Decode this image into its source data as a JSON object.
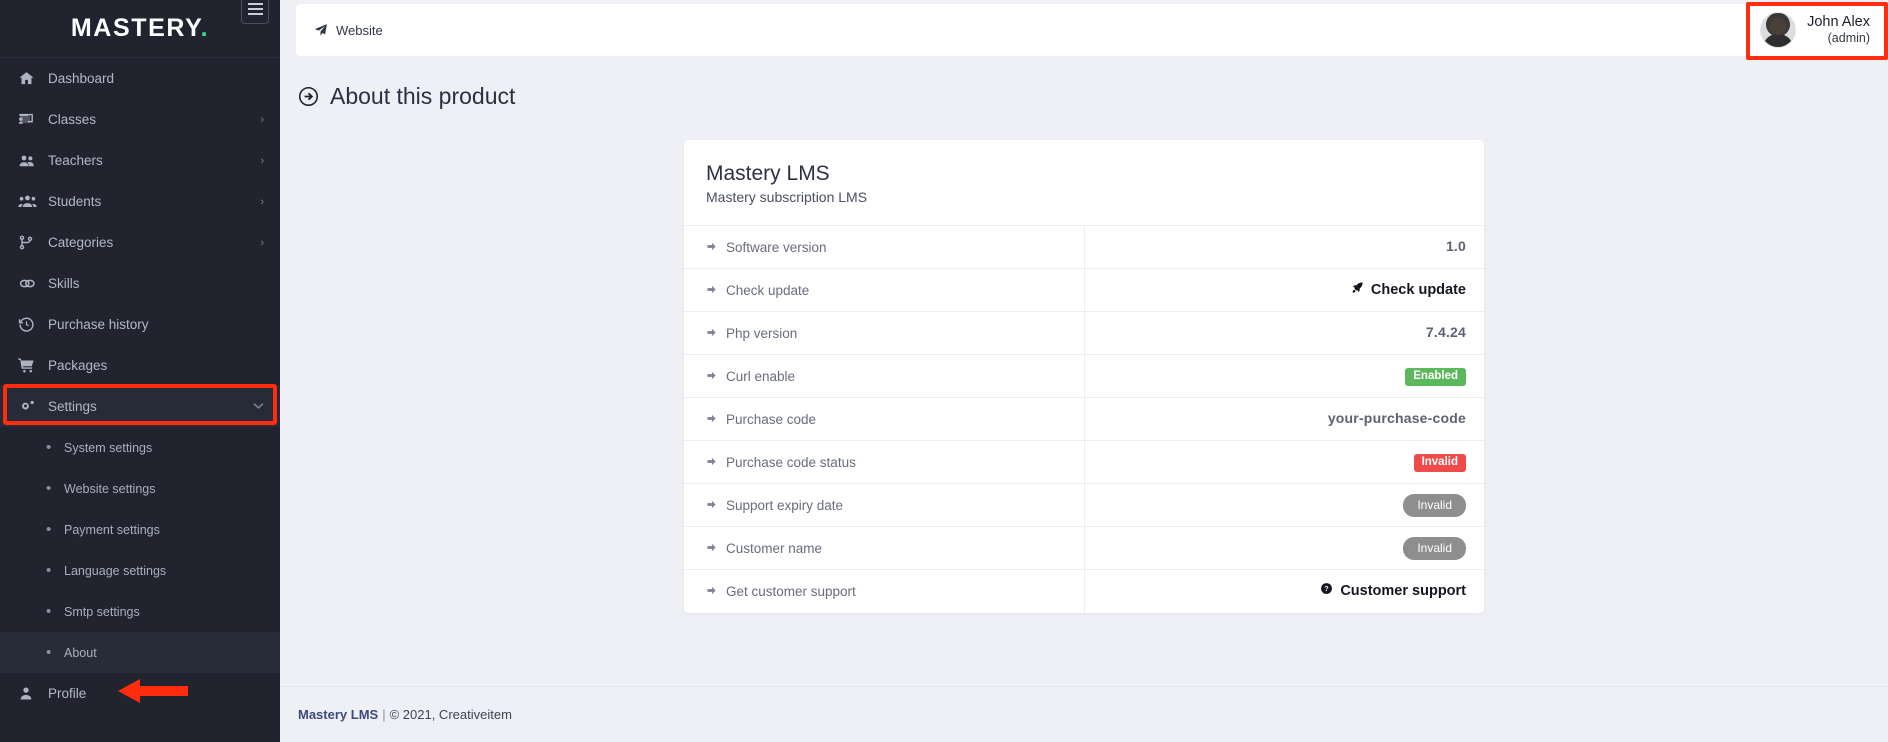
{
  "brand": {
    "name": "MASTERY",
    "dot": ".",
    "accent": "#3ddc84"
  },
  "sidebar": {
    "menu_icon": "hamburger-icon",
    "items": [
      {
        "label": "Dashboard",
        "icon": "home-icon",
        "caret": ""
      },
      {
        "label": "Classes",
        "icon": "classes-icon",
        "caret": "›"
      },
      {
        "label": "Teachers",
        "icon": "teachers-icon",
        "caret": "›"
      },
      {
        "label": "Students",
        "icon": "students-icon",
        "caret": "›"
      },
      {
        "label": "Categories",
        "icon": "category-icon",
        "caret": "›"
      },
      {
        "label": "Skills",
        "icon": "skills-icon",
        "caret": ""
      },
      {
        "label": "Purchase history",
        "icon": "history-icon",
        "caret": ""
      },
      {
        "label": "Packages",
        "icon": "cart-icon",
        "caret": ""
      }
    ],
    "settings": {
      "label": "Settings",
      "icon": "gears-icon",
      "caret": "⌄"
    },
    "sub_items": [
      {
        "label": "System settings"
      },
      {
        "label": "Website settings"
      },
      {
        "label": "Payment settings"
      },
      {
        "label": "Language settings"
      },
      {
        "label": "Smtp settings"
      },
      {
        "label": "About"
      }
    ],
    "profile": {
      "label": "Profile",
      "icon": "user-icon"
    }
  },
  "topbar": {
    "breadcrumb": "Website",
    "breadcrumb_icon": "paper-plane-icon",
    "user": {
      "name": "John Alex",
      "role": "(admin)",
      "avatar": "user-avatar"
    }
  },
  "page": {
    "title": "About this product",
    "title_icon": "arrow-circle-right-icon"
  },
  "card": {
    "title": "Mastery LMS",
    "subtitle": "Mastery subscription LMS",
    "rows": [
      {
        "key": "Software version",
        "type": "text",
        "value": "1.0"
      },
      {
        "key": "Check update",
        "type": "link",
        "value": "Check update",
        "icon": "rocket-icon"
      },
      {
        "key": "Php version",
        "type": "text",
        "value": "7.4.24"
      },
      {
        "key": "Curl enable",
        "type": "badge",
        "value": "Enabled",
        "color": "#5cb85c",
        "shape": "square"
      },
      {
        "key": "Purchase code",
        "type": "text",
        "value": "your-purchase-code"
      },
      {
        "key": "Purchase code status",
        "type": "badge",
        "value": "Invalid",
        "color": "#f04b4b",
        "shape": "square"
      },
      {
        "key": "Support expiry date",
        "type": "badge",
        "value": "Invalid",
        "color": "#8e8e8e",
        "shape": "pill"
      },
      {
        "key": "Customer name",
        "type": "badge",
        "value": "Invalid",
        "color": "#8e8e8e",
        "shape": "pill"
      },
      {
        "key": "Get customer support",
        "type": "link",
        "value": "Customer support",
        "icon": "question-circle-icon"
      }
    ]
  },
  "footer": {
    "brand": "Mastery LMS",
    "separator": "|",
    "copyright": "© 2021, Creativeitem"
  },
  "annotations": {
    "highlight_color": "#ff2d0d"
  }
}
